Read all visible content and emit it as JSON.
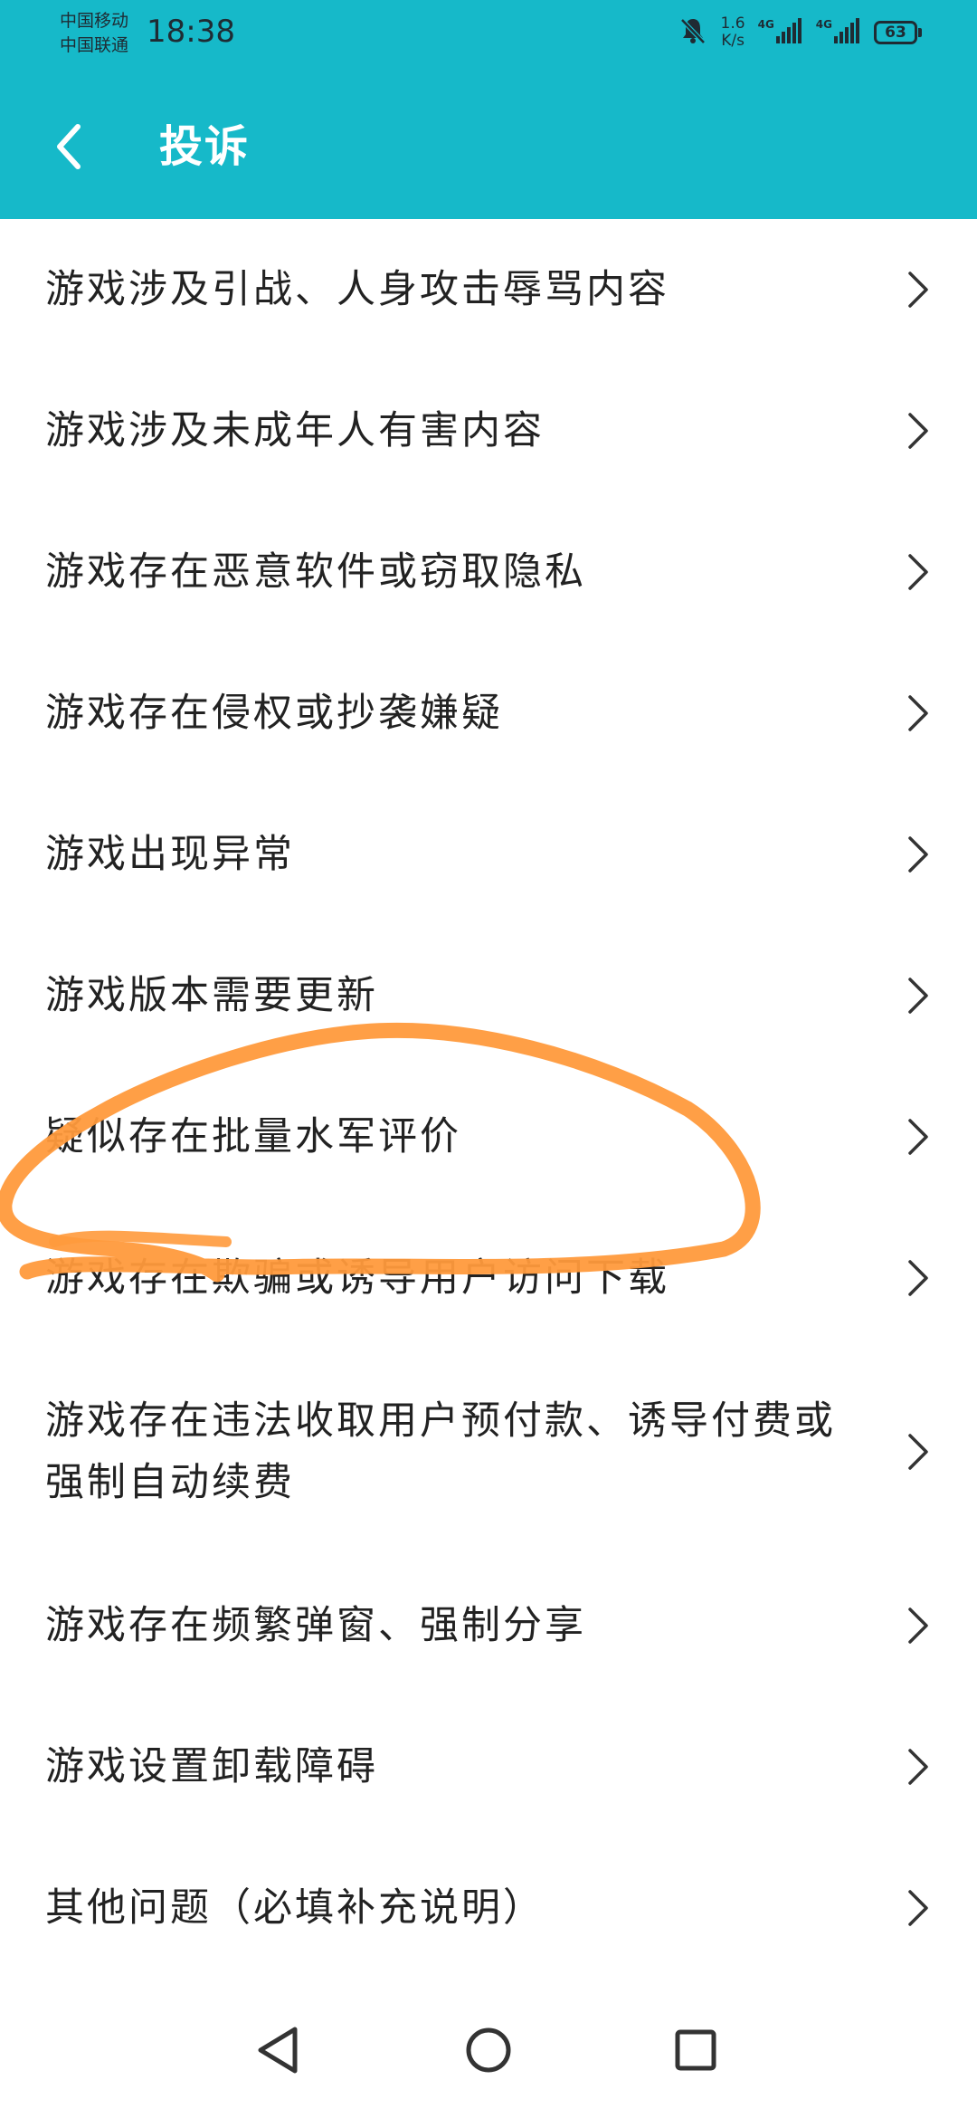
{
  "status_bar": {
    "carrier_1": "中国移动",
    "carrier_2": "中国联通",
    "time": "18:38",
    "speed_value": "1.6",
    "speed_unit": "K/s",
    "network_1": "4G",
    "network_2": "4G",
    "battery": "63",
    "icons": [
      "mute-bell-icon",
      "signal-icon",
      "signal-icon",
      "battery-icon"
    ]
  },
  "header": {
    "title": "投诉",
    "back_icon": "back-arrow-icon",
    "background_color": "#16b9c9"
  },
  "complaint_items": [
    "游戏涉及引战、人身攻击辱骂内容",
    "游戏涉及未成年人有害内容",
    "游戏存在恶意软件或窃取隐私",
    "游戏存在侵权或抄袭嫌疑",
    "游戏出现异常",
    "游戏版本需要更新",
    "疑似存在批量水军评价",
    "游戏存在欺骗或诱导用户访问下载",
    "游戏存在违法收取用户预付款、诱导付费或强制自动续费",
    "游戏存在频繁弹窗、强制分享",
    "游戏设置卸载障碍",
    "其他问题（必填补充说明）"
  ],
  "annotation": {
    "shape": "hand-drawn circle around item 7",
    "color": "#ff9a3c"
  },
  "nav_bar": {
    "icons": [
      "back-triangle-icon",
      "home-circle-icon",
      "recents-square-icon"
    ]
  }
}
